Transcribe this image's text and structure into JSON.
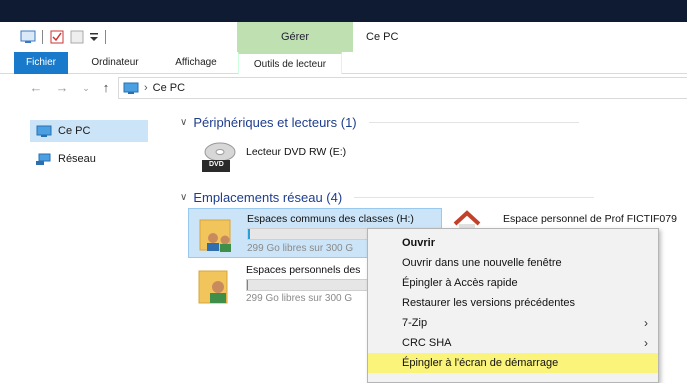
{
  "quick_access": {
    "icons": [
      "properties-icon",
      "new-folder-icon",
      "customize-arrow-icon"
    ]
  },
  "ribbon": {
    "manage_tab": "Gérer",
    "window_title": "Ce PC",
    "tabs": [
      "Fichier",
      "Ordinateur",
      "Affichage",
      "Outils de lecteur"
    ]
  },
  "address": {
    "path": "Ce PC"
  },
  "sidebar": {
    "items": [
      {
        "label": "Ce PC",
        "icon": "pc-icon"
      },
      {
        "label": "Réseau",
        "icon": "network-icon"
      }
    ]
  },
  "main": {
    "devices_header": "Périphériques et lecteurs (1)",
    "dvd_label": "Lecteur DVD RW (E:)",
    "dvd_badge": "DVD",
    "network_header": "Emplacements réseau (4)",
    "drives": [
      {
        "name": "Espaces communs des classes (H:)",
        "free": "299 Go libres sur 300 G",
        "used_fraction": 0.01
      },
      {
        "name": "Espaces personnels des",
        "free": "299 Go libres sur 300 G",
        "used_fraction": 0.01
      },
      {
        "name": "Espace personnel de Prof FICTIF079"
      }
    ]
  },
  "context_menu": {
    "items": [
      {
        "label": "Ouvrir",
        "bold": true
      },
      {
        "label": "Ouvrir dans une nouvelle fenêtre"
      },
      {
        "label": "Épingler à Accès rapide"
      },
      {
        "label": "Restaurer les versions précédentes"
      },
      {
        "label": "7-Zip",
        "submenu": true
      },
      {
        "label": "CRC SHA",
        "submenu": true
      },
      {
        "label": "Épingler à l'écran de démarrage",
        "highlighted": true
      }
    ]
  },
  "colors": {
    "accent": "#1979ca",
    "manage_green": "#bfe0b0",
    "selection": "#cce4f7",
    "highlight": "#fbf47a"
  }
}
